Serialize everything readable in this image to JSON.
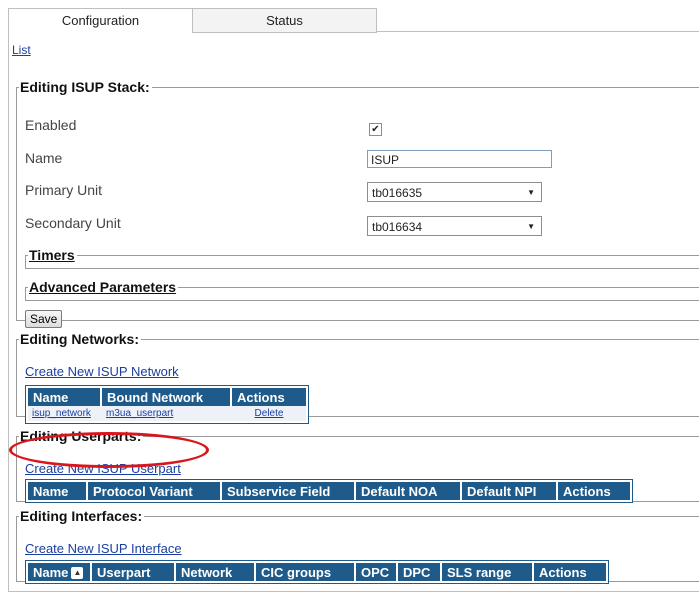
{
  "tabs": [
    {
      "label": "Configuration",
      "active": true
    },
    {
      "label": "Status",
      "active": false
    }
  ],
  "list_link": "List",
  "stack": {
    "legend": "Editing ISUP Stack:",
    "fields": {
      "enabled_label": "Enabled",
      "enabled_checked": true,
      "name_label": "Name",
      "name_value": "ISUP",
      "primary_label": "Primary Unit",
      "primary_value": "tb016635",
      "secondary_label": "Secondary Unit",
      "secondary_value": "tb016634"
    },
    "timers_legend": "Timers",
    "advanced_legend": "Advanced Parameters",
    "save_label": "Save"
  },
  "networks": {
    "legend": "Editing Networks:",
    "create_link": "Create New ISUP Network",
    "columns": [
      "Name",
      "Bound Network",
      "Actions"
    ],
    "rows": [
      {
        "name": "isup_network",
        "bound": "m3ua_userpart",
        "action": "Delete"
      }
    ]
  },
  "userparts": {
    "legend": "Editing Userparts:",
    "create_link": "Create New ISUP Userpart",
    "columns": [
      "Name",
      "Protocol Variant",
      "Subservice Field",
      "Default NOA",
      "Default NPI",
      "Actions"
    ]
  },
  "interfaces": {
    "legend": "Editing Interfaces:",
    "create_link": "Create New ISUP Interface",
    "columns": [
      "Name",
      "Userpart",
      "Network",
      "CIC groups",
      "OPC",
      "DPC",
      "SLS range",
      "Actions"
    ]
  },
  "colors": {
    "table_header": "#1e5a8a",
    "link": "#1a3fa0",
    "highlight": "#d9161c"
  },
  "icons": {
    "sort": "sort-ascending-icon",
    "checkmark": "checkmark-icon",
    "dropdown": "dropdown-arrow-icon"
  }
}
